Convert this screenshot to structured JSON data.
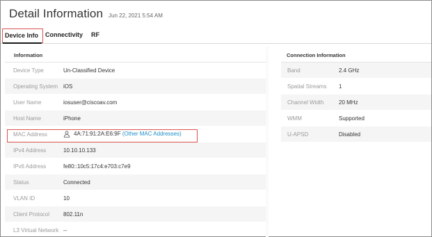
{
  "header": {
    "title": "Detail Information",
    "timestamp": "Jun 22, 2021 5:54 AM"
  },
  "tabs": [
    {
      "label": "Device Info",
      "active": true
    },
    {
      "label": "Connectivity",
      "active": false
    },
    {
      "label": "RF",
      "active": false
    }
  ],
  "information": {
    "heading": "Information",
    "rows": [
      {
        "label": "Device Type",
        "value": "Un-Classified Device"
      },
      {
        "label": "Operating System",
        "value": "iOS"
      },
      {
        "label": "User Name",
        "value": "iosuser@ciscoav.com"
      },
      {
        "label": "Host Name",
        "value": "iPhone"
      },
      {
        "label": "MAC Address",
        "value": "4A:71:91:2A:E6:9F",
        "link": "(Other MAC Addresses)",
        "icon": "user-icon"
      },
      {
        "label": "IPv4 Address",
        "value": "10.10.10.133"
      },
      {
        "label": "IPv6 Address",
        "value": "fe80::10c5:17c4:e703:c7e9"
      },
      {
        "label": "Status",
        "value": "Connected"
      },
      {
        "label": "VLAN ID",
        "value": "10"
      },
      {
        "label": "Client Protocol",
        "value": "802.11n"
      },
      {
        "label": "L3 Virtual Network",
        "value": "--"
      }
    ]
  },
  "connection": {
    "heading": "Connection Information",
    "rows": [
      {
        "label": "Band",
        "value": "2.4 GHz"
      },
      {
        "label": "Spatial Streams",
        "value": "1"
      },
      {
        "label": "Channel Width",
        "value": "20 MHz"
      },
      {
        "label": "WMM",
        "value": "Supported"
      },
      {
        "label": "U-APSD",
        "value": "Disabled"
      }
    ]
  },
  "colors": {
    "highlight": "#d9534f",
    "link": "#1b8ec8",
    "label": "#9a9a9a",
    "stripe": "#f5f5f5"
  }
}
